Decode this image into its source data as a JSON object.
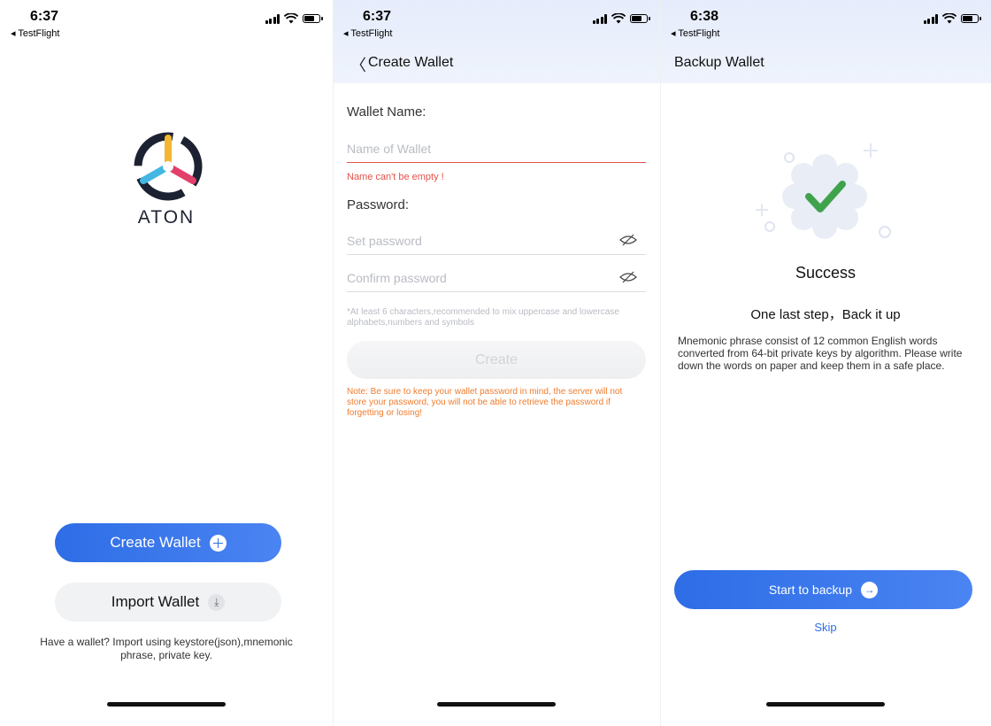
{
  "status_bars": [
    {
      "time": "6:37",
      "back_app": "◂ TestFlight"
    },
    {
      "time": "6:37",
      "back_app": "◂ TestFlight"
    },
    {
      "time": "6:38",
      "back_app": "◂ TestFlight"
    }
  ],
  "welcome": {
    "logo_text": "ATON",
    "create_wallet": "Create Wallet",
    "import_wallet": "Import Wallet",
    "hint": "Have a wallet? Import using keystore(json),mnemonic phrase, private key."
  },
  "create_wallet": {
    "back_icon": "chevron-left-icon",
    "title": "Create Wallet",
    "wallet_name_label": "Wallet Name:",
    "wallet_name_placeholder": "Name of Wallet",
    "wallet_name_value": "",
    "error": "Name can't be empty !",
    "password_label": "Password:",
    "set_password_placeholder": "Set password",
    "confirm_password_placeholder": "Confirm password",
    "tip": "*At least 6 characters,recommended to mix uppercase and lowercase alphabets,numbers and symbols",
    "create_button": "Create",
    "note": "Note: Be sure to keep your wallet password in mind, the server will not store your password, you will not be able to retrieve the password if forgetting or losing!"
  },
  "backup": {
    "title": "Backup Wallet",
    "success": "Success",
    "last_step": "One last step，Back it up",
    "description": "Mnemonic phrase consist of 12 common English words converted from 64-bit private keys by algorithm. Please write down the words on paper and keep them in a safe place.",
    "start_button": "Start to backup",
    "skip": "Skip"
  },
  "colors": {
    "primary": "#2f6ee6",
    "error": "#e2514a",
    "note": "#ef7c2e",
    "header_bg": "#e6ecfb",
    "success_green": "#3fa34d"
  }
}
